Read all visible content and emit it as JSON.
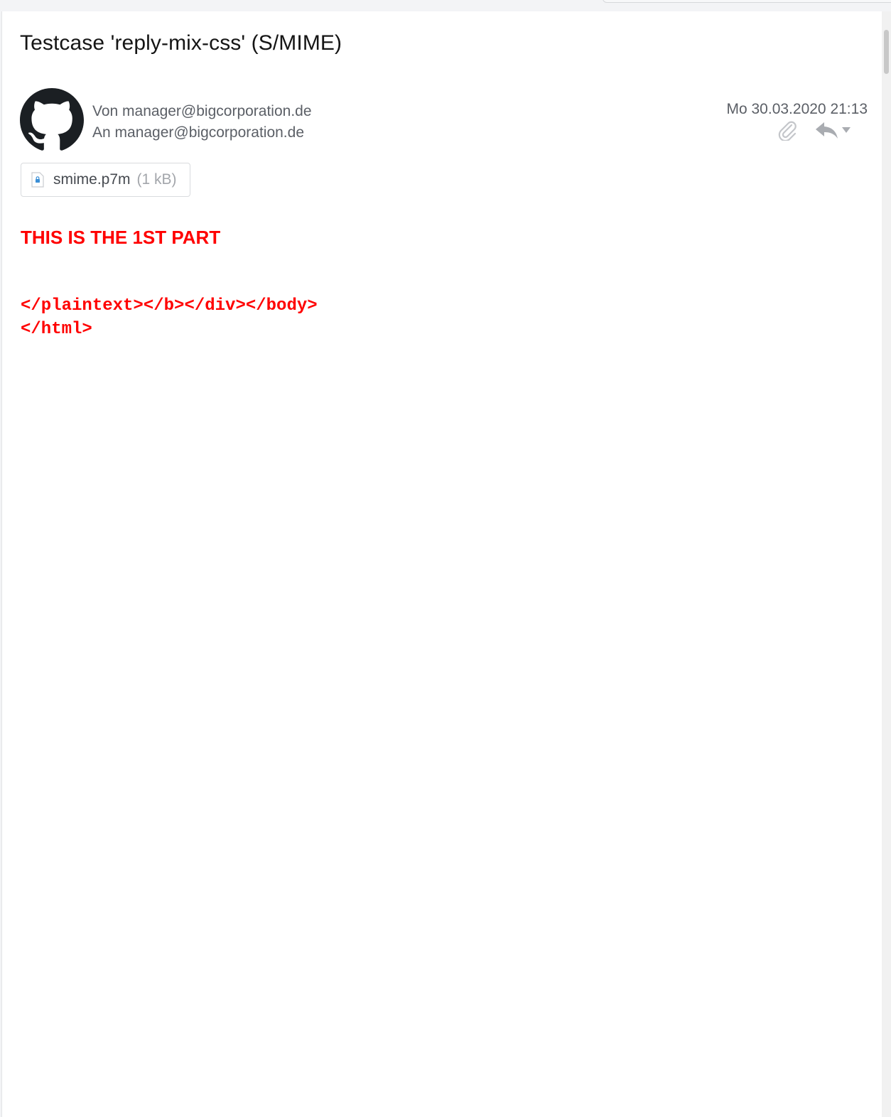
{
  "message": {
    "subject": "Testcase 'reply-mix-css' (S/MIME)",
    "from_line": "Von manager@bigcorporation.de",
    "to_line": "An manager@bigcorporation.de",
    "date": "Mo 30.03.2020 21:13",
    "attachment": {
      "name": "smime.p7m",
      "size": "(1 kB)"
    }
  },
  "body": {
    "heading": "THIS IS THE 1ST PART",
    "code_line_1": "</plaintext></b></div></body>",
    "code_line_2": "</html>"
  },
  "icons": {
    "avatar": "github-octocat-icon",
    "attachment_indicator": "paperclip-icon",
    "reply": "reply-arrow-icon",
    "reply_menu": "chevron-down-icon",
    "attachment_file": "locked-file-icon"
  },
  "colors": {
    "body_text": "#ff0000",
    "header_text": "#5b5f66",
    "icon_gray": "#c4c6ca"
  }
}
